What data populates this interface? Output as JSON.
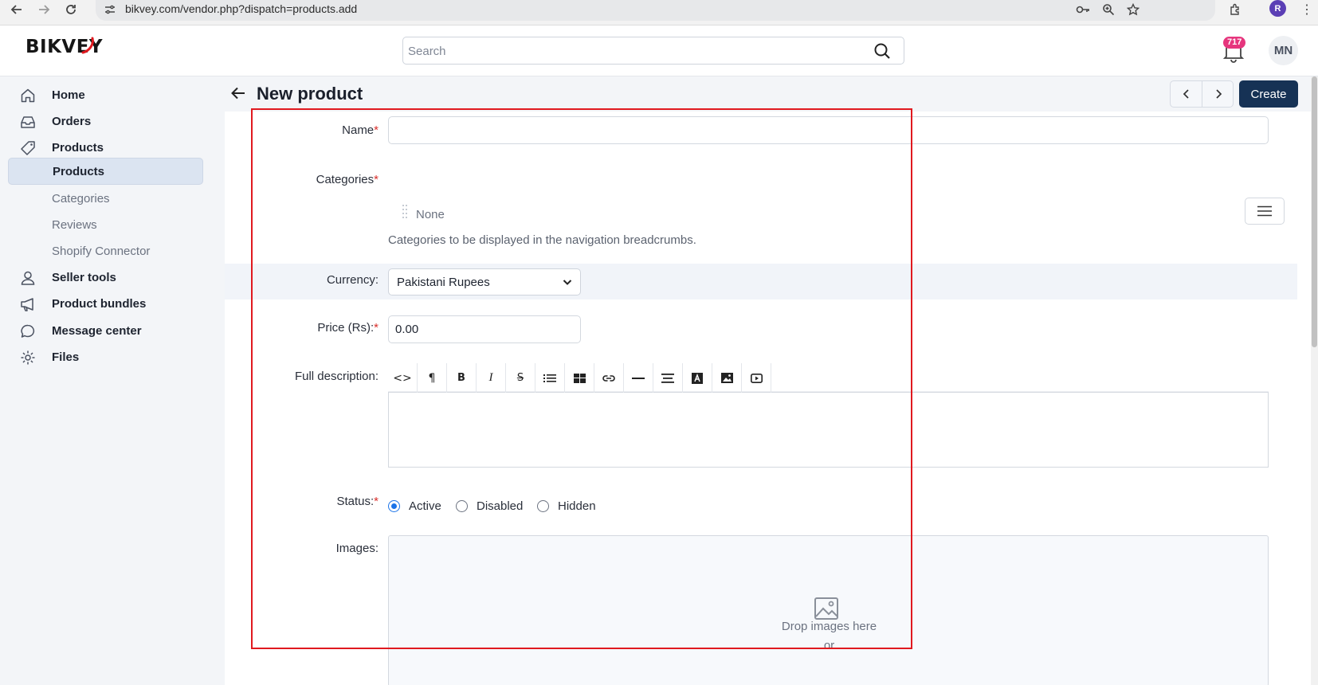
{
  "browser": {
    "url": "bikvey.com/vendor.php?dispatch=products.add",
    "profile_initial": "R"
  },
  "header": {
    "logo_text": "BIKVEY",
    "search_placeholder": "Search",
    "notification_count": "717",
    "user_initials": "MN"
  },
  "sidebar": {
    "items": [
      {
        "label": "Home",
        "icon": "home-icon"
      },
      {
        "label": "Orders",
        "icon": "inbox-icon"
      },
      {
        "label": "Products",
        "icon": "tag-icon"
      },
      {
        "label": "Products",
        "sub": true,
        "active": true
      },
      {
        "label": "Categories",
        "sub": true
      },
      {
        "label": "Reviews",
        "sub": true
      },
      {
        "label": "Shopify Connector",
        "sub": true
      },
      {
        "label": "Seller tools",
        "icon": "user-icon"
      },
      {
        "label": "Product bundles",
        "icon": "megaphone-icon"
      },
      {
        "label": "Message center",
        "icon": "chat-bubble-icon"
      },
      {
        "label": "Files",
        "icon": "gear-icon"
      }
    ]
  },
  "page": {
    "title": "New product",
    "create_label": "Create"
  },
  "form": {
    "name_label": "Name",
    "required_mark": "*",
    "categories_label": "Categories",
    "categories_value": "None",
    "categories_hint": "Categories to be displayed in the navigation breadcrumbs.",
    "currency_label": "Currency:",
    "currency_value": "Pakistani Rupees",
    "price_label": "Price (Rs):",
    "price_value": "0.00",
    "description_label": "Full description:",
    "toolbar_buttons": [
      "code-view",
      "paragraph",
      "bold",
      "italic",
      "strikethrough",
      "bulleted-list",
      "table",
      "link",
      "horizontal-rule",
      "align",
      "font-color",
      "image",
      "video"
    ],
    "status_label": "Status:",
    "status_options": [
      {
        "label": "Active",
        "checked": true
      },
      {
        "label": "Disabled",
        "checked": false
      },
      {
        "label": "Hidden",
        "checked": false
      }
    ],
    "images_label": "Images:",
    "dropzone_text": "Drop images here",
    "dropzone_or": "or"
  },
  "colors": {
    "primary": "#163255",
    "badge": "#e6357d",
    "highlight": "#e0191f",
    "radio_active": "#1a73e8"
  }
}
